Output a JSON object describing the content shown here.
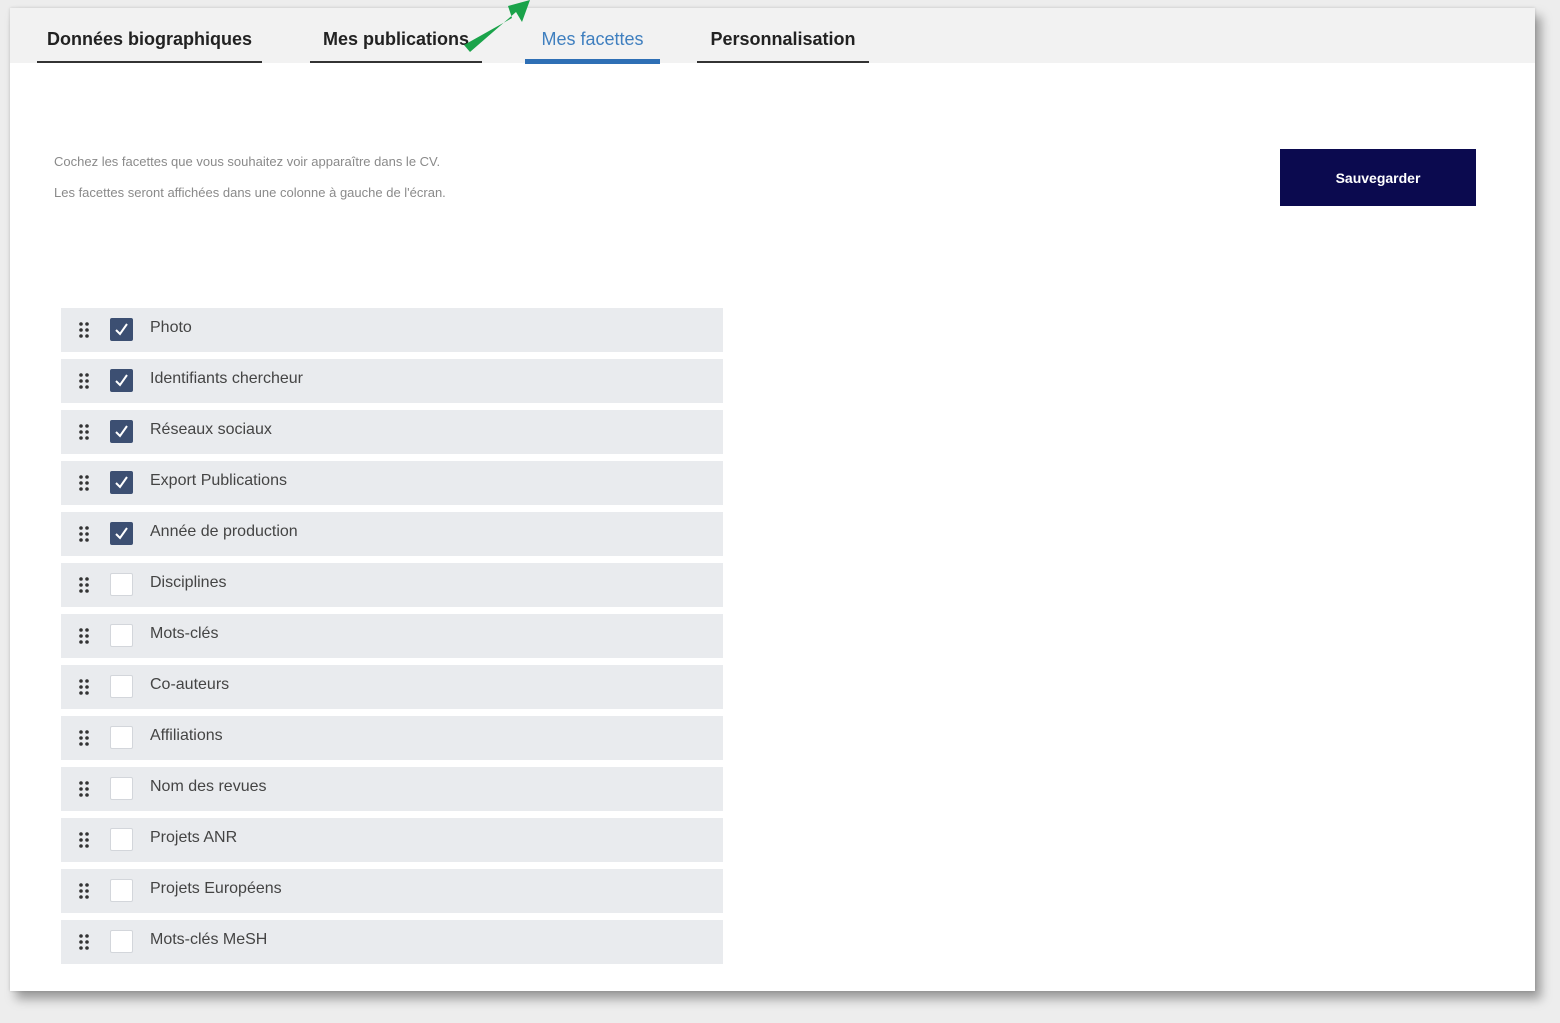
{
  "tabs": [
    {
      "label": "Données biographiques",
      "active": false
    },
    {
      "label": "Mes publications",
      "active": false
    },
    {
      "label": "Mes facettes",
      "active": true
    },
    {
      "label": "Personnalisation",
      "active": false
    }
  ],
  "intro": {
    "line1": "Cochez les facettes que vous souhaitez voir apparaître dans le CV.",
    "line2": "Les facettes seront affichées dans une colonne à gauche de l'écran."
  },
  "save_button": {
    "label": "Sauvegarder"
  },
  "facets": [
    {
      "label": "Photo",
      "checked": true
    },
    {
      "label": "Identifiants chercheur",
      "checked": true
    },
    {
      "label": "Réseaux sociaux",
      "checked": true
    },
    {
      "label": "Export Publications",
      "checked": true
    },
    {
      "label": "Année de production",
      "checked": true
    },
    {
      "label": "Disciplines",
      "checked": false
    },
    {
      "label": "Mots-clés",
      "checked": false
    },
    {
      "label": "Co-auteurs",
      "checked": false
    },
    {
      "label": "Affiliations",
      "checked": false
    },
    {
      "label": "Nom des revues",
      "checked": false
    },
    {
      "label": "Projets ANR",
      "checked": false
    },
    {
      "label": "Projets Européens",
      "checked": false
    },
    {
      "label": "Mots-clés MeSH",
      "checked": false
    }
  ],
  "colors": {
    "accent": "#2e6fb5",
    "button": "#0b0a4f",
    "checkbox_checked": "#3c4f72",
    "arrow": "#1aa34a"
  }
}
